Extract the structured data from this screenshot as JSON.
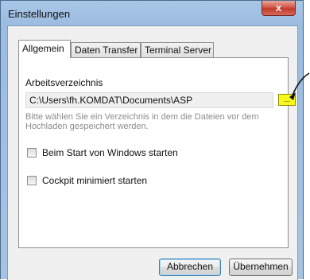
{
  "window": {
    "title": "Einstellungen",
    "close_label": "x"
  },
  "tabs": [
    {
      "label": "Allgemein",
      "active": true
    },
    {
      "label": "Daten Transfer",
      "active": false
    },
    {
      "label": "Terminal Server",
      "active": false
    }
  ],
  "general": {
    "workdir_label": "Arbeitsverzeichnis",
    "workdir_value": "C:\\Users\\fh.KOMDAT\\Documents\\ASP",
    "browse_label": "...",
    "browse_color": "#f8f81a",
    "hint": "Bitte wählen Sie ein Verzeichnis in dem die Dateien vor dem Hochladen gespeichert werden.",
    "checkboxes": [
      {
        "label": "Beim Start von Windows starten",
        "checked": false
      },
      {
        "label": "Cockpit minimiert starten",
        "checked": false
      }
    ]
  },
  "buttons": {
    "cancel": "Abbrechen",
    "apply": "Übernehmen"
  },
  "annotation": {
    "icon": "arrow-annotation-icon"
  }
}
